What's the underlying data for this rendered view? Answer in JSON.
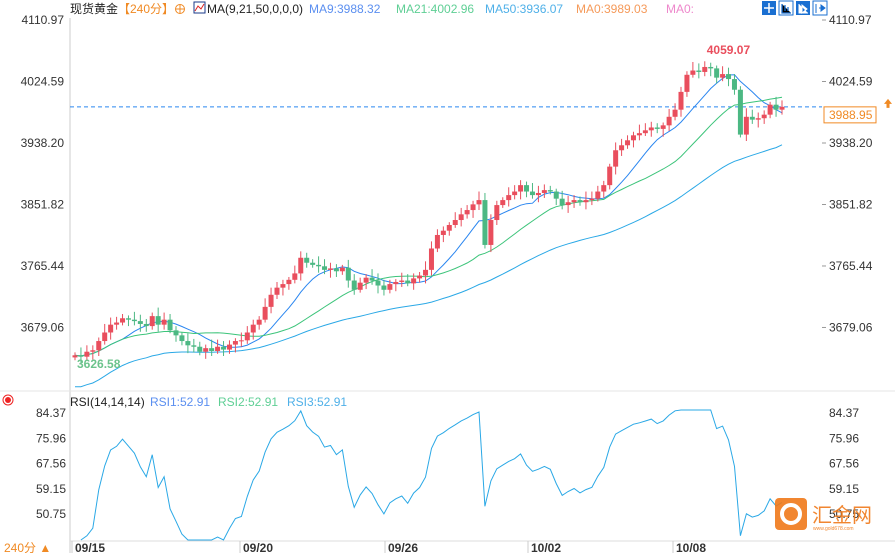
{
  "header": {
    "symbol": "现货黄金",
    "period": "【240分】",
    "ma_title": "MA(9,21,50,0,0,0)",
    "ma9": "MA9:3988.32",
    "ma21": "MA21:4002.96",
    "ma50": "MA50:3936.07",
    "ma0a": "MA0:3989.03",
    "ma0b": "MA0:"
  },
  "rsi_header": {
    "title": "RSI(14,14,14)",
    "rsi1": "RSI1:52.91",
    "rsi2": "RSI2:52.91",
    "rsi3": "RSI3:52.91"
  },
  "toolbar": [
    "crosshair-icon",
    "zoom-in-icon",
    "pan-icon",
    "exit-icon"
  ],
  "footer": {
    "period_selector": "240分 ▲",
    "logo_text": "汇金网",
    "logo_url_text": "www.gold678.com"
  },
  "colors": {
    "up": "#e94e5d",
    "down": "#4cb883",
    "ma9": "#2a86f0",
    "ma21": "#3cc47a",
    "ma50": "#2aa8e6",
    "rsi": "#2aa8e6",
    "current": "#f08a24",
    "high_label": "#e94e5d",
    "low_label": "#6cc38c"
  },
  "chart_data": [
    {
      "type": "candlestick",
      "title": "现货黄金 240分",
      "price_ticks": [
        "4110.97",
        "4024.59",
        "3938.20",
        "3851.82",
        "3765.44",
        "3679.06"
      ],
      "ylim": [
        3600,
        4110.97
      ],
      "x_ticks": [
        "09/15",
        "09/20",
        "09/26",
        "10/02",
        "10/08"
      ],
      "current_price": "3988.95",
      "high_label": "4059.07",
      "low_label": "3626.58",
      "closes": [
        3640,
        3638,
        3645,
        3647,
        3660,
        3672,
        3683,
        3686,
        3692,
        3690,
        3688,
        3684,
        3681,
        3695,
        3683,
        3690,
        3675,
        3668,
        3660,
        3654,
        3652,
        3645,
        3650,
        3646,
        3652,
        3648,
        3655,
        3660,
        3661,
        3672,
        3683,
        3690,
        3708,
        3725,
        3735,
        3740,
        3746,
        3755,
        3777,
        3770,
        3767,
        3765,
        3760,
        3762,
        3758,
        3763,
        3745,
        3732,
        3742,
        3749,
        3745,
        3738,
        3732,
        3740,
        3743,
        3745,
        3741,
        3748,
        3752,
        3760,
        3790,
        3809,
        3815,
        3823,
        3830,
        3838,
        3844,
        3852,
        3858,
        3795,
        3830,
        3851,
        3858,
        3865,
        3870,
        3879,
        3870,
        3865,
        3868,
        3872,
        3870,
        3860,
        3851,
        3855,
        3858,
        3855,
        3858,
        3860,
        3870,
        3879,
        3905,
        3928,
        3935,
        3942,
        3949,
        3952,
        3956,
        3960,
        3958,
        3963,
        3975,
        3985,
        4010,
        4034,
        4040,
        4038,
        4045,
        4043,
        4030,
        4035,
        4028,
        4013,
        3950,
        3975,
        3971,
        3973,
        3978,
        3992,
        3985,
        3989
      ],
      "ma_periods": [
        9,
        21,
        50
      ]
    },
    {
      "type": "line",
      "title": "RSI(14,14,14)",
      "ticks": [
        "84.37",
        "75.96",
        "67.56",
        "59.15",
        "50.75"
      ],
      "ylim": [
        42,
        88
      ]
    }
  ]
}
